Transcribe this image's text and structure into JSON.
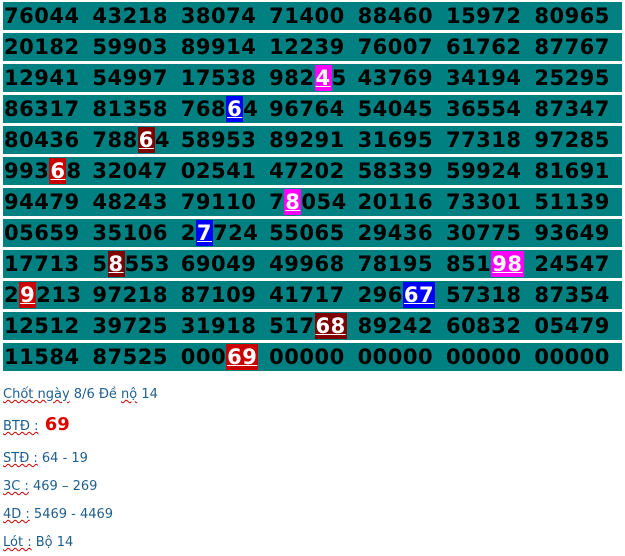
{
  "table": {
    "rows": [
      [
        [
          "76044"
        ],
        [
          "43218"
        ],
        [
          "38074"
        ],
        [
          "71400"
        ],
        [
          "88460"
        ],
        [
          "15972"
        ],
        [
          "80965"
        ]
      ],
      [
        [
          "20182"
        ],
        [
          "59903"
        ],
        [
          "89914"
        ],
        [
          "12239"
        ],
        [
          "76007"
        ],
        [
          "61762"
        ],
        [
          "87767"
        ]
      ],
      [
        [
          "12941"
        ],
        [
          "54997"
        ],
        [
          "17538"
        ],
        [
          "982",
          "4",
          "5"
        ],
        [
          "43769"
        ],
        [
          "34194"
        ],
        [
          "25295"
        ]
      ],
      [
        [
          "86317"
        ],
        [
          "81358"
        ],
        [
          "768",
          "6",
          "4"
        ],
        [
          "96764"
        ],
        [
          "54045"
        ],
        [
          "36554"
        ],
        [
          "87347"
        ]
      ],
      [
        [
          "80436"
        ],
        [
          "788",
          "6",
          "4"
        ],
        [
          "58953"
        ],
        [
          "89291"
        ],
        [
          "31695"
        ],
        [
          "77318"
        ],
        [
          "97285"
        ]
      ],
      [
        [
          "993",
          "6",
          "8"
        ],
        [
          "32047"
        ],
        [
          "02541"
        ],
        [
          "47202"
        ],
        [
          "58339"
        ],
        [
          "59924"
        ],
        [
          "81691"
        ]
      ],
      [
        [
          "94479"
        ],
        [
          "48243"
        ],
        [
          "79110"
        ],
        [
          "7",
          "8",
          "054"
        ],
        [
          "20116"
        ],
        [
          "73301"
        ],
        [
          "51139"
        ]
      ],
      [
        [
          "05659"
        ],
        [
          "35106"
        ],
        [
          "2",
          "7",
          "724"
        ],
        [
          "55065"
        ],
        [
          "29436"
        ],
        [
          "30775"
        ],
        [
          "93649"
        ]
      ],
      [
        [
          "17713"
        ],
        [
          "5",
          "8",
          "553"
        ],
        [
          "69049"
        ],
        [
          "49968"
        ],
        [
          "78195"
        ],
        [
          "851",
          "98",
          ""
        ],
        [
          "24547"
        ]
      ],
      [
        [
          "2",
          "9",
          "213"
        ],
        [
          "97218"
        ],
        [
          "87109"
        ],
        [
          "41717"
        ],
        [
          "296",
          "67",
          ""
        ],
        [
          "57318"
        ],
        [
          "87354"
        ]
      ],
      [
        [
          "12512"
        ],
        [
          "39725"
        ],
        [
          "31918"
        ],
        [
          "517",
          "68",
          ""
        ],
        [
          "89242"
        ],
        [
          "60832"
        ],
        [
          "05479"
        ]
      ],
      [
        [
          "11584"
        ],
        [
          "87525"
        ],
        [
          "000",
          "69",
          ""
        ],
        [
          "00000"
        ],
        [
          "00000"
        ],
        [
          "00000"
        ],
        [
          "00000"
        ]
      ]
    ],
    "highlight_colors": {
      "2-3": "#ff00ff",
      "3-2": "#0000ff",
      "4-1": "#800000",
      "5-0": "#cc0000",
      "6-3": "#ff00ff",
      "7-2": "#0000ff",
      "8-1": "#800000",
      "8-5": "#ff00ff",
      "9-0": "#cc0000",
      "9-4": "#0000ff",
      "10-3": "#800000",
      "11-2": "#cc0000"
    },
    "row_color": "#008080"
  },
  "notes": {
    "line1": {
      "label": "Chốt ngày",
      "text": " 8/6 Đề ",
      "label2": "nộ",
      "text2": " 14"
    },
    "line2": {
      "label": "BTĐ :",
      "value": " 69"
    },
    "line3": {
      "label": "STĐ :",
      "value": " 64 - 19"
    },
    "line4": {
      "label": "3C :",
      "value": " 469 – 269"
    },
    "line5": {
      "label": "4D :",
      "value": " 5469 - 4469"
    },
    "line6": {
      "label": "Lót :",
      "value": " Bộ 14"
    }
  }
}
